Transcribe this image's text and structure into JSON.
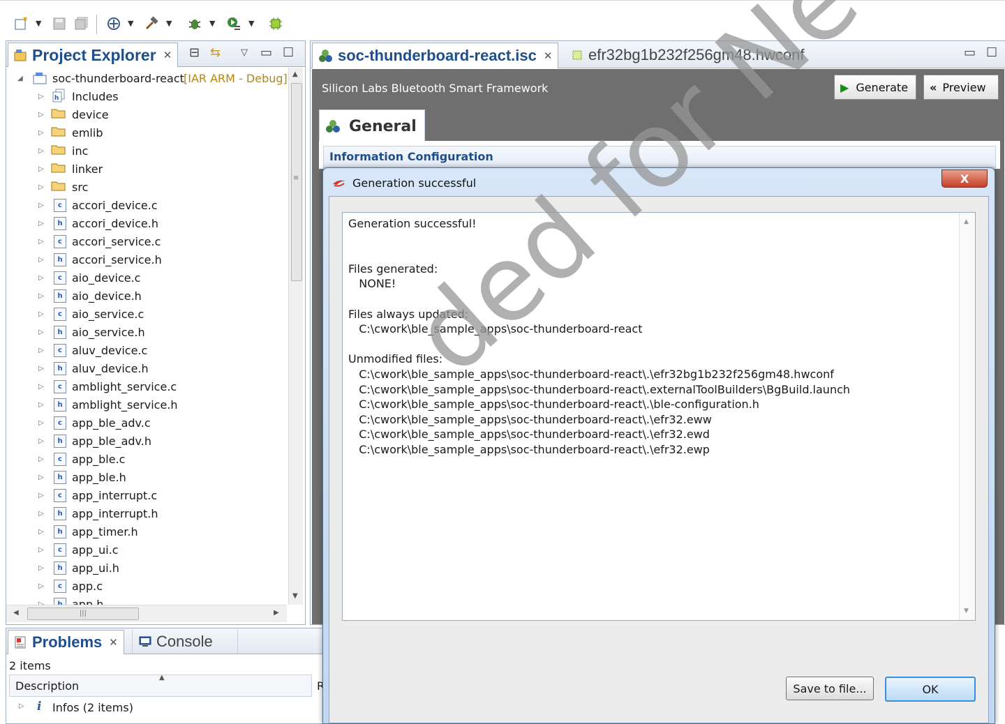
{
  "toolbar": {
    "icons": [
      "new-wizard-icon",
      "save-icon",
      "save-all-icon",
      "build-all-icon",
      "hammer-icon",
      "debug-icon",
      "run-icon",
      "chip-icon"
    ]
  },
  "project_explorer": {
    "title": "Project Explorer",
    "root": {
      "label": "soc-thunderboard-react",
      "suffix": "[IAR ARM - Debug]"
    },
    "items": [
      {
        "label": "Includes",
        "type": "includes"
      },
      {
        "label": "device",
        "type": "folder"
      },
      {
        "label": "emlib",
        "type": "folder"
      },
      {
        "label": "inc",
        "type": "folder"
      },
      {
        "label": "linker",
        "type": "folder"
      },
      {
        "label": "src",
        "type": "folder"
      },
      {
        "label": "accori_device.c",
        "type": "c"
      },
      {
        "label": "accori_device.h",
        "type": "h"
      },
      {
        "label": "accori_service.c",
        "type": "c"
      },
      {
        "label": "accori_service.h",
        "type": "h"
      },
      {
        "label": "aio_device.c",
        "type": "c"
      },
      {
        "label": "aio_device.h",
        "type": "h"
      },
      {
        "label": "aio_service.c",
        "type": "c"
      },
      {
        "label": "aio_service.h",
        "type": "h"
      },
      {
        "label": "aluv_device.c",
        "type": "c"
      },
      {
        "label": "aluv_device.h",
        "type": "h"
      },
      {
        "label": "amblight_service.c",
        "type": "c"
      },
      {
        "label": "amblight_service.h",
        "type": "h"
      },
      {
        "label": "app_ble_adv.c",
        "type": "c"
      },
      {
        "label": "app_ble_adv.h",
        "type": "h"
      },
      {
        "label": "app_ble.c",
        "type": "c"
      },
      {
        "label": "app_ble.h",
        "type": "h"
      },
      {
        "label": "app_interrupt.c",
        "type": "c"
      },
      {
        "label": "app_interrupt.h",
        "type": "h"
      },
      {
        "label": "app_timer.h",
        "type": "h"
      },
      {
        "label": "app_ui.c",
        "type": "c"
      },
      {
        "label": "app_ui.h",
        "type": "h"
      },
      {
        "label": "app.c",
        "type": "c"
      },
      {
        "label": "app.h",
        "type": "h"
      }
    ]
  },
  "editor": {
    "tabs": [
      {
        "label": "soc-thunderboard-react.isc",
        "active": true
      },
      {
        "label": "efr32bg1b232f256gm48.hwconf",
        "active": false
      }
    ],
    "framework_title": "Silicon Labs Bluetooth Smart Framework",
    "generate_label": "Generate",
    "preview_label": "Preview",
    "section_tab": "General",
    "section_title": "Information Configuration"
  },
  "problems": {
    "tabs": [
      "Problems",
      "Console"
    ],
    "count": "2 items",
    "column": "Description",
    "column2_partial": "R",
    "row": "Infos (2 items)"
  },
  "dialog": {
    "title": "Generation successful",
    "close_label": "X",
    "lines": [
      "Generation successful!",
      "",
      "",
      "Files generated:",
      "   NONE!",
      "",
      "Files always updated:",
      "   C:\\cwork\\ble_sample_apps\\soc-thunderboard-react",
      "",
      "Unmodified files:",
      "   C:\\cwork\\ble_sample_apps\\soc-thunderboard-react\\.\\efr32bg1b232f256gm48.hwconf",
      "   C:\\cwork\\ble_sample_apps\\soc-thunderboard-react\\.externalToolBuilders\\BgBuild.launch",
      "   C:\\cwork\\ble_sample_apps\\soc-thunderboard-react\\.\\ble-configuration.h",
      "   C:\\cwork\\ble_sample_apps\\soc-thunderboard-react\\.\\efr32.eww",
      "   C:\\cwork\\ble_sample_apps\\soc-thunderboard-react\\.\\efr32.ewd",
      "   C:\\cwork\\ble_sample_apps\\soc-thunderboard-react\\.\\efr32.ewp"
    ],
    "save_label": "Save to file...",
    "ok_label": "OK"
  },
  "watermark": "ded for New Design",
  "colors": {
    "accent": "#1f4e8c",
    "header_gray": "#6f6f6f",
    "dialog_frame": "#c0d8f1"
  }
}
